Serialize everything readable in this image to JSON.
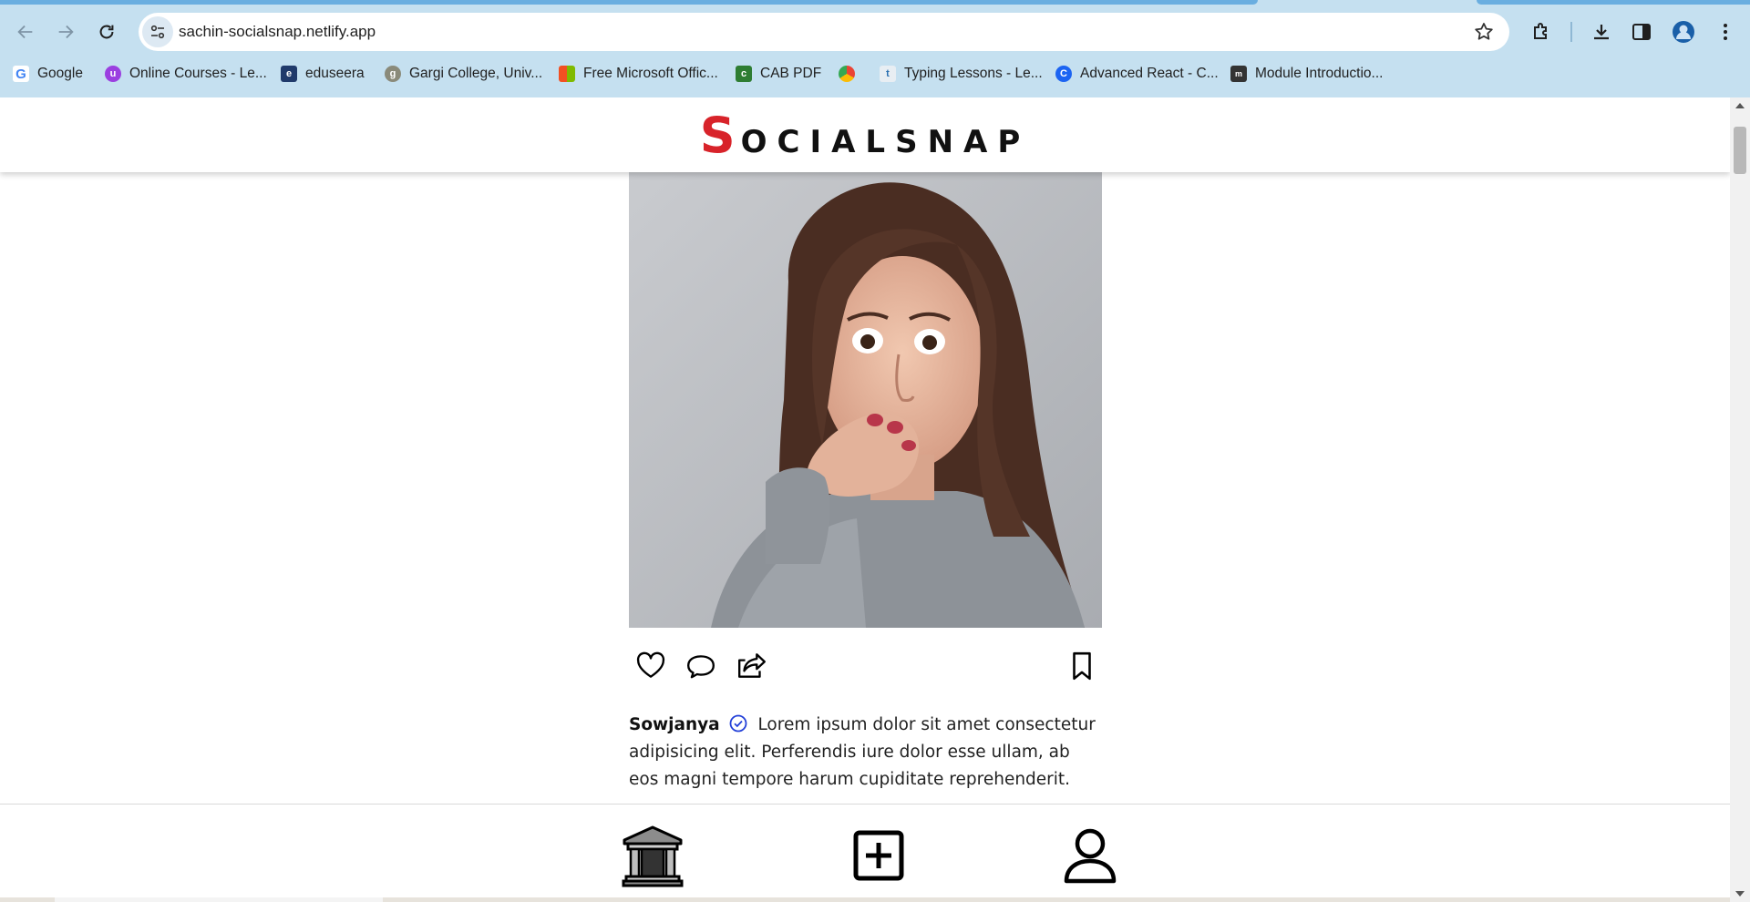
{
  "browser": {
    "url": "sachin-socialsnap.netlify.app",
    "bookmarks": [
      {
        "label": "Google",
        "icon": "google-icon"
      },
      {
        "label": "Online Courses - Le...",
        "icon": "online-courses-icon"
      },
      {
        "label": "eduseera",
        "icon": "eduseera-icon"
      },
      {
        "label": "Gargi College, Univ...",
        "icon": "gargi-college-icon"
      },
      {
        "label": "Free Microsoft Offic...",
        "icon": "microsoft-icon"
      },
      {
        "label": "CAB PDF",
        "icon": "cab-pdf-icon"
      },
      {
        "label": "",
        "icon": "chrome-icon"
      },
      {
        "label": "Typing Lessons - Le...",
        "icon": "typing-lessons-icon"
      },
      {
        "label": "Advanced React - C...",
        "icon": "advanced-react-icon"
      },
      {
        "label": "Module Introductio...",
        "icon": "module-icon"
      }
    ]
  },
  "app": {
    "logo_first": "S",
    "logo_rest": "OCIALSNAP"
  },
  "post": {
    "username": "Sowjanya",
    "caption": "Lorem ipsum dolor sit amet consectetur adipisicing elit. Perferendis iure dolor esse ullam, ab eos magni tempore harum cupiditate reprehenderit.",
    "actions": [
      "heart-icon",
      "comment-icon",
      "share-icon",
      "bookmark-icon"
    ]
  },
  "bottom_nav": [
    "home-icon",
    "add-post-icon",
    "profile-icon"
  ],
  "colors": {
    "brand_red": "#d8232a",
    "chrome_blue": "#c5e0f0",
    "verified_blue": "#2340d8"
  }
}
